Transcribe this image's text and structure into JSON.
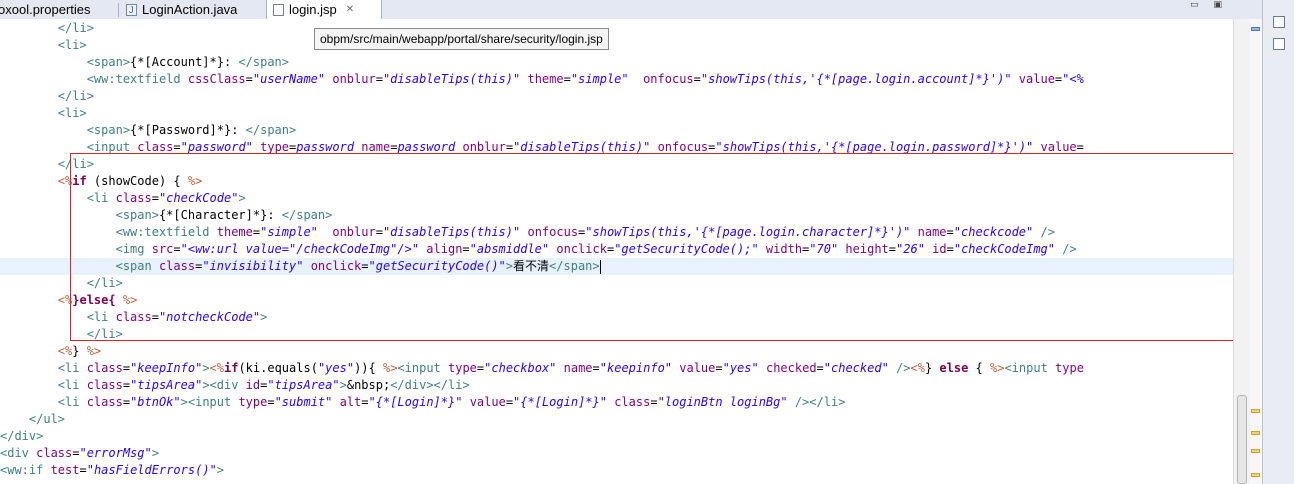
{
  "tabs": [
    {
      "label": "oxool.properties",
      "active": false,
      "icon": "properties-file-icon"
    },
    {
      "label": "LoginAction.java",
      "active": false,
      "icon": "java-file-icon"
    },
    {
      "label": "login.jsp",
      "active": true,
      "icon": "jsp-file-icon",
      "close": "✕"
    }
  ],
  "window_controls": {
    "minimize": "▭",
    "maximize": "▣"
  },
  "tooltip": "obpm/src/main/webapp/portal/share/security/login.jsp",
  "colors": {
    "tag": "#3f7f7f",
    "attribute": "#7f007f",
    "string": "#2a00ff",
    "scriptlet": "#bf5f3f",
    "keyword": "#7f0055",
    "highlight_box": "#d9262e"
  },
  "code_lines": [
    {
      "current": false,
      "tokens": [
        [
          "tg",
          "        </li>"
        ]
      ]
    },
    {
      "current": false,
      "tokens": [
        [
          "tg",
          "        <li>"
        ]
      ]
    },
    {
      "current": false,
      "tokens": [
        [
          "tg",
          "            <span>"
        ],
        [
          "tx",
          "{*[Account]*}: "
        ],
        [
          "tg",
          "</span>"
        ]
      ]
    },
    {
      "current": false,
      "tokens": [
        [
          "tg",
          "            <ww:textfield "
        ],
        [
          "at",
          "cssClass"
        ],
        [
          "tx",
          "="
        ],
        [
          "st",
          "\"userName\""
        ],
        [
          "tx",
          " "
        ],
        [
          "at",
          "onblur"
        ],
        [
          "tx",
          "="
        ],
        [
          "st",
          "\"disableTips(this)\""
        ],
        [
          "tx",
          " "
        ],
        [
          "at",
          "theme"
        ],
        [
          "tx",
          "="
        ],
        [
          "st",
          "\"simple\""
        ],
        [
          "tx",
          "  "
        ],
        [
          "at",
          "onfocus"
        ],
        [
          "tx",
          "="
        ],
        [
          "st",
          "\"showTips(this,'{*[page.login.account]*}')\""
        ],
        [
          "tx",
          " "
        ],
        [
          "at",
          "value"
        ],
        [
          "tx",
          "="
        ],
        [
          "st",
          "\"<%"
        ]
      ]
    },
    {
      "current": false,
      "tokens": [
        [
          "tg",
          "        </li>"
        ]
      ]
    },
    {
      "current": false,
      "tokens": [
        [
          "tg",
          "        <li>"
        ]
      ]
    },
    {
      "current": false,
      "tokens": [
        [
          "tg",
          "            <span>"
        ],
        [
          "tx",
          "{*[Password]*}: "
        ],
        [
          "tg",
          "</span>"
        ]
      ]
    },
    {
      "current": false,
      "tokens": [
        [
          "tg",
          "            <input "
        ],
        [
          "at",
          "class"
        ],
        [
          "tx",
          "="
        ],
        [
          "st",
          "\"password\""
        ],
        [
          "tx",
          " "
        ],
        [
          "at",
          "type"
        ],
        [
          "tx",
          "="
        ],
        [
          "st",
          "password"
        ],
        [
          "tx",
          " "
        ],
        [
          "at",
          "name"
        ],
        [
          "tx",
          "="
        ],
        [
          "st",
          "password"
        ],
        [
          "tx",
          " "
        ],
        [
          "at",
          "onblur"
        ],
        [
          "tx",
          "="
        ],
        [
          "st",
          "\"disableTips(this)\""
        ],
        [
          "tx",
          " "
        ],
        [
          "at",
          "onfocus"
        ],
        [
          "tx",
          "="
        ],
        [
          "st",
          "\"showTips(this,'{*[page.login.password]*}')\""
        ],
        [
          "tx",
          " "
        ],
        [
          "at",
          "value"
        ],
        [
          "tx",
          "="
        ]
      ]
    },
    {
      "current": false,
      "tokens": [
        [
          "tg",
          "        </li>"
        ]
      ]
    },
    {
      "current": false,
      "tokens": [
        [
          "ku",
          "        <%"
        ],
        [
          "kw",
          "if"
        ],
        [
          "tx",
          " (showCode) { "
        ],
        [
          "ku",
          "%>"
        ]
      ]
    },
    {
      "current": false,
      "tokens": [
        [
          "tg",
          "            <li "
        ],
        [
          "at",
          "class"
        ],
        [
          "tx",
          "="
        ],
        [
          "st",
          "\"checkCode\""
        ],
        [
          "tg",
          ">"
        ]
      ]
    },
    {
      "current": false,
      "tokens": [
        [
          "tg",
          "                <span>"
        ],
        [
          "tx",
          "{*[Character]*}: "
        ],
        [
          "tg",
          "</span>"
        ]
      ]
    },
    {
      "current": false,
      "tokens": [
        [
          "tg",
          "                <ww:textfield "
        ],
        [
          "at",
          "theme"
        ],
        [
          "tx",
          "="
        ],
        [
          "st",
          "\"simple\""
        ],
        [
          "tx",
          "  "
        ],
        [
          "at",
          "onblur"
        ],
        [
          "tx",
          "="
        ],
        [
          "st",
          "\"disableTips(this)\""
        ],
        [
          "tx",
          " "
        ],
        [
          "at",
          "onfocus"
        ],
        [
          "tx",
          "="
        ],
        [
          "st",
          "\"showTips(this,'{*[page.login.character]*}')\""
        ],
        [
          "tx",
          " "
        ],
        [
          "at",
          "name"
        ],
        [
          "tx",
          "="
        ],
        [
          "st",
          "\"checkcode\""
        ],
        [
          "tg",
          " />"
        ]
      ]
    },
    {
      "current": false,
      "tokens": [
        [
          "tg",
          "                <img "
        ],
        [
          "at",
          "src"
        ],
        [
          "tx",
          "="
        ],
        [
          "st",
          "\"<ww:url value=\"/checkCodeImg\"/>\""
        ],
        [
          "tx",
          " "
        ],
        [
          "at",
          "align"
        ],
        [
          "tx",
          "="
        ],
        [
          "st",
          "\"absmiddle\""
        ],
        [
          "tx",
          " "
        ],
        [
          "at",
          "onclick"
        ],
        [
          "tx",
          "="
        ],
        [
          "st",
          "\"getSecurityCode();\""
        ],
        [
          "tx",
          " "
        ],
        [
          "at",
          "width"
        ],
        [
          "tx",
          "="
        ],
        [
          "st",
          "\"70\""
        ],
        [
          "tx",
          " "
        ],
        [
          "at",
          "height"
        ],
        [
          "tx",
          "="
        ],
        [
          "st",
          "\"26\""
        ],
        [
          "tx",
          " "
        ],
        [
          "at",
          "id"
        ],
        [
          "tx",
          "="
        ],
        [
          "st",
          "\"checkCodeImg\""
        ],
        [
          "tg",
          " />"
        ]
      ]
    },
    {
      "current": true,
      "tokens": [
        [
          "tg",
          "                <span "
        ],
        [
          "at",
          "class"
        ],
        [
          "tx",
          "="
        ],
        [
          "st",
          "\"invisibility\""
        ],
        [
          "tx",
          " "
        ],
        [
          "at",
          "onclick"
        ],
        [
          "tx",
          "="
        ],
        [
          "st",
          "\"getSecurityCode()\""
        ],
        [
          "tg",
          ">"
        ],
        [
          "ch",
          "看不清"
        ],
        [
          "tg",
          "</span>"
        ],
        [
          "caret",
          ""
        ]
      ]
    },
    {
      "current": false,
      "tokens": [
        [
          "tg",
          "            </li>"
        ]
      ]
    },
    {
      "current": false,
      "tokens": [
        [
          "ku",
          "        <%"
        ],
        [
          "kw",
          "}else{"
        ],
        [
          "tx",
          " "
        ],
        [
          "ku",
          "%>"
        ]
      ]
    },
    {
      "current": false,
      "tokens": [
        [
          "tg",
          "            <li "
        ],
        [
          "at",
          "class"
        ],
        [
          "tx",
          "="
        ],
        [
          "st",
          "\"notcheckCode\""
        ],
        [
          "tg",
          ">"
        ]
      ]
    },
    {
      "current": false,
      "tokens": [
        [
          "tg",
          "            </li>"
        ]
      ]
    },
    {
      "current": false,
      "tokens": [
        [
          "ku",
          "        <%"
        ],
        [
          "tx",
          "} "
        ],
        [
          "ku",
          "%>"
        ]
      ]
    },
    {
      "current": false,
      "tokens": [
        [
          "tg",
          "        <li "
        ],
        [
          "at",
          "class"
        ],
        [
          "tx",
          "="
        ],
        [
          "st",
          "\"keepInfo\""
        ],
        [
          "tg",
          ">"
        ],
        [
          "ku",
          "<%"
        ],
        [
          "kw",
          "if"
        ],
        [
          "tx",
          "(ki.equals("
        ],
        [
          "st",
          "\"yes\""
        ],
        [
          "tx",
          ")){ "
        ],
        [
          "ku",
          "%>"
        ],
        [
          "tg",
          "<input "
        ],
        [
          "at",
          "type"
        ],
        [
          "tx",
          "="
        ],
        [
          "st",
          "\"checkbox\""
        ],
        [
          "tx",
          " "
        ],
        [
          "at",
          "name"
        ],
        [
          "tx",
          "="
        ],
        [
          "st",
          "\"keepinfo\""
        ],
        [
          "tx",
          " "
        ],
        [
          "at",
          "value"
        ],
        [
          "tx",
          "="
        ],
        [
          "st",
          "\"yes\""
        ],
        [
          "tx",
          " "
        ],
        [
          "at",
          "checked"
        ],
        [
          "tx",
          "="
        ],
        [
          "st",
          "\"checked\""
        ],
        [
          "tg",
          " />"
        ],
        [
          "ku",
          "<%"
        ],
        [
          "tx",
          "} "
        ],
        [
          "kw",
          "else"
        ],
        [
          "tx",
          " { "
        ],
        [
          "ku",
          "%>"
        ],
        [
          "tg",
          "<input "
        ],
        [
          "at",
          "type"
        ]
      ]
    },
    {
      "current": false,
      "tokens": [
        [
          "tg",
          "        <li "
        ],
        [
          "at",
          "class"
        ],
        [
          "tx",
          "="
        ],
        [
          "st",
          "\"tipsArea\""
        ],
        [
          "tg",
          "><div "
        ],
        [
          "at",
          "id"
        ],
        [
          "tx",
          "="
        ],
        [
          "st",
          "\"tipsArea\""
        ],
        [
          "tg",
          ">"
        ],
        [
          "tx",
          "&nbsp;"
        ],
        [
          "tg",
          "</div></li>"
        ]
      ]
    },
    {
      "current": false,
      "tokens": [
        [
          "tg",
          "        <li "
        ],
        [
          "at",
          "class"
        ],
        [
          "tx",
          "="
        ],
        [
          "st",
          "\"btnOk\""
        ],
        [
          "tg",
          "><input "
        ],
        [
          "at",
          "type"
        ],
        [
          "tx",
          "="
        ],
        [
          "st",
          "\"submit\""
        ],
        [
          "tx",
          " "
        ],
        [
          "at",
          "alt"
        ],
        [
          "tx",
          "="
        ],
        [
          "st",
          "\"{*[Login]*}\""
        ],
        [
          "tx",
          " "
        ],
        [
          "at",
          "value"
        ],
        [
          "tx",
          "="
        ],
        [
          "st",
          "\"{*[Login]*}\""
        ],
        [
          "tx",
          " "
        ],
        [
          "at",
          "class"
        ],
        [
          "tx",
          "="
        ],
        [
          "st",
          "\"loginBtn loginBg\""
        ],
        [
          "tg",
          " /></li>"
        ]
      ]
    },
    {
      "current": false,
      "tokens": [
        [
          "tg",
          "    </ul>"
        ]
      ]
    },
    {
      "current": false,
      "tokens": [
        [
          "tg",
          "</div>"
        ]
      ]
    },
    {
      "current": false,
      "tokens": [
        [
          "tg",
          "<div "
        ],
        [
          "at",
          "class"
        ],
        [
          "tx",
          "="
        ],
        [
          "st",
          "\"errorMsg\""
        ],
        [
          "tg",
          ">"
        ]
      ]
    },
    {
      "current": false,
      "tokens": [
        [
          "tg",
          "<ww:if "
        ],
        [
          "at",
          "test"
        ],
        [
          "tx",
          "="
        ],
        [
          "st",
          "\"hasFieldErrors()\""
        ],
        [
          "tg",
          ">"
        ]
      ]
    }
  ]
}
